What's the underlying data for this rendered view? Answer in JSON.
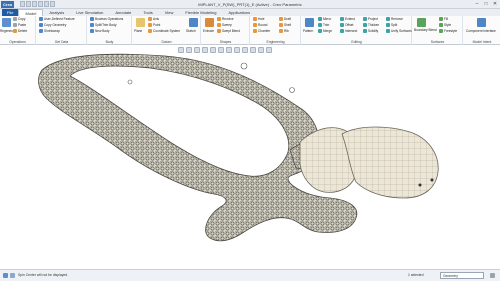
{
  "window": {
    "app_badge": "Creo",
    "title": "IMPLANT_V_P(SW)_PRT(1)_E (Active) - Creo Parametric",
    "minimize": "–",
    "maximize": "□",
    "close": "✕"
  },
  "tabs": [
    {
      "label": "File"
    },
    {
      "label": "Model"
    },
    {
      "label": "Analysis"
    },
    {
      "label": "Live Simulation"
    },
    {
      "label": "Annotate"
    },
    {
      "label": "Tools"
    },
    {
      "label": "View"
    },
    {
      "label": "Flexible Modeling"
    },
    {
      "label": "Applications"
    }
  ],
  "ribbon": {
    "operations": {
      "label": "Operations",
      "regenerate": "Regenerate",
      "copy": "Copy",
      "paste": "Paste",
      "delete": "Delete"
    },
    "get_data": {
      "label": "Get Data",
      "user_defined": "User-Defined Feature",
      "copy_geometry": "Copy Geometry",
      "shrinkwrap": "Shrinkwrap"
    },
    "body": {
      "label": "Body",
      "boolean": "Boolean Operations",
      "split": "Split/Trim Body",
      "new_body": "New Body"
    },
    "datum": {
      "label": "Datum",
      "plane": "Plane",
      "axis": "Axis",
      "point": "Point",
      "csys": "Coordinate System",
      "sketch": "Sketch"
    },
    "shapes": {
      "label": "Shapes",
      "extrude": "Extrude",
      "revolve": "Revolve",
      "sweep": "Sweep",
      "swept_blend": "Swept Blend"
    },
    "engineering": {
      "label": "Engineering",
      "hole": "Hole",
      "round": "Round",
      "chamfer": "Chamfer",
      "draft": "Draft",
      "shell": "Shell",
      "rib": "Rib"
    },
    "editing": {
      "label": "Editing",
      "pattern": "Pattern",
      "mirror": "Mirror",
      "trim": "Trim",
      "merge": "Merge",
      "extend": "Extend",
      "offset": "Offset",
      "intersect": "Intersect",
      "project": "Project",
      "thicken": "Thicken",
      "solidify": "Solidify",
      "remove": "Remove",
      "split": "Split",
      "unify": "Unify Surfaces"
    },
    "surfaces": {
      "label": "Surfaces",
      "boundary": "Boundary Blend",
      "fill": "Fill",
      "style": "Style",
      "freestyle": "Freestyle"
    },
    "model_intent": {
      "label": "Model Intent",
      "component_interface": "Component Interface"
    }
  },
  "status": {
    "message": "Spin Center will not be displayed.",
    "selected": "1 selected",
    "filter": "Geometry"
  }
}
